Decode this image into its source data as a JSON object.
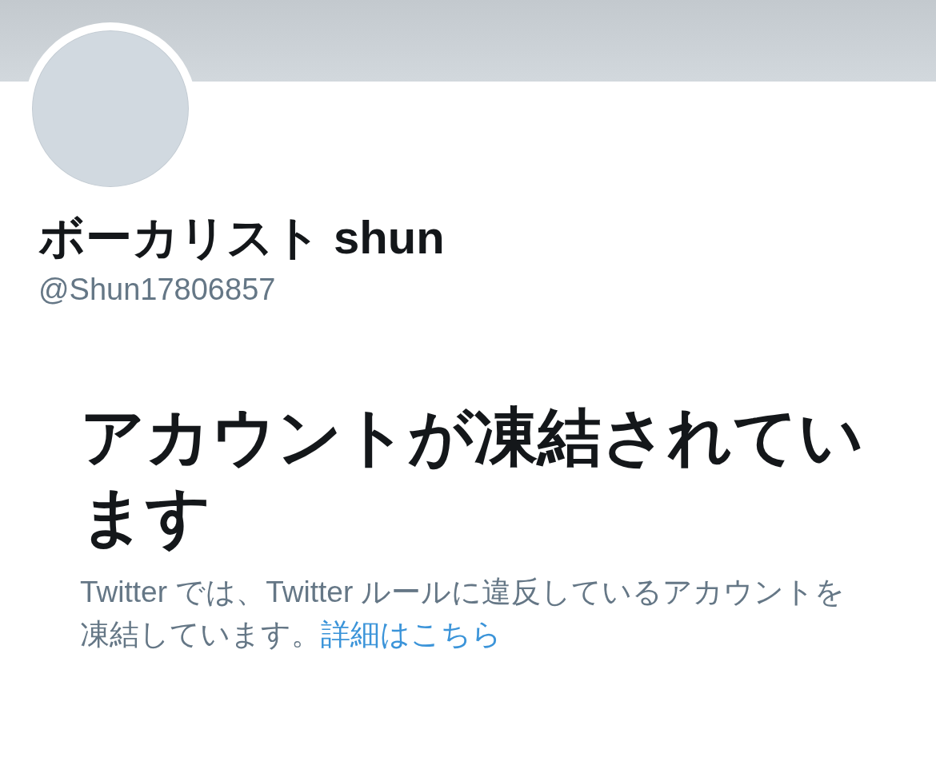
{
  "profile": {
    "name": "ボーカリスト shun",
    "handle": "@Shun17806857"
  },
  "notice": {
    "title": "アカウントが凍結されています",
    "text": "Twitter では、Twitter ルールに違反しているアカウントを凍結しています。",
    "link": "詳細はこちら"
  }
}
